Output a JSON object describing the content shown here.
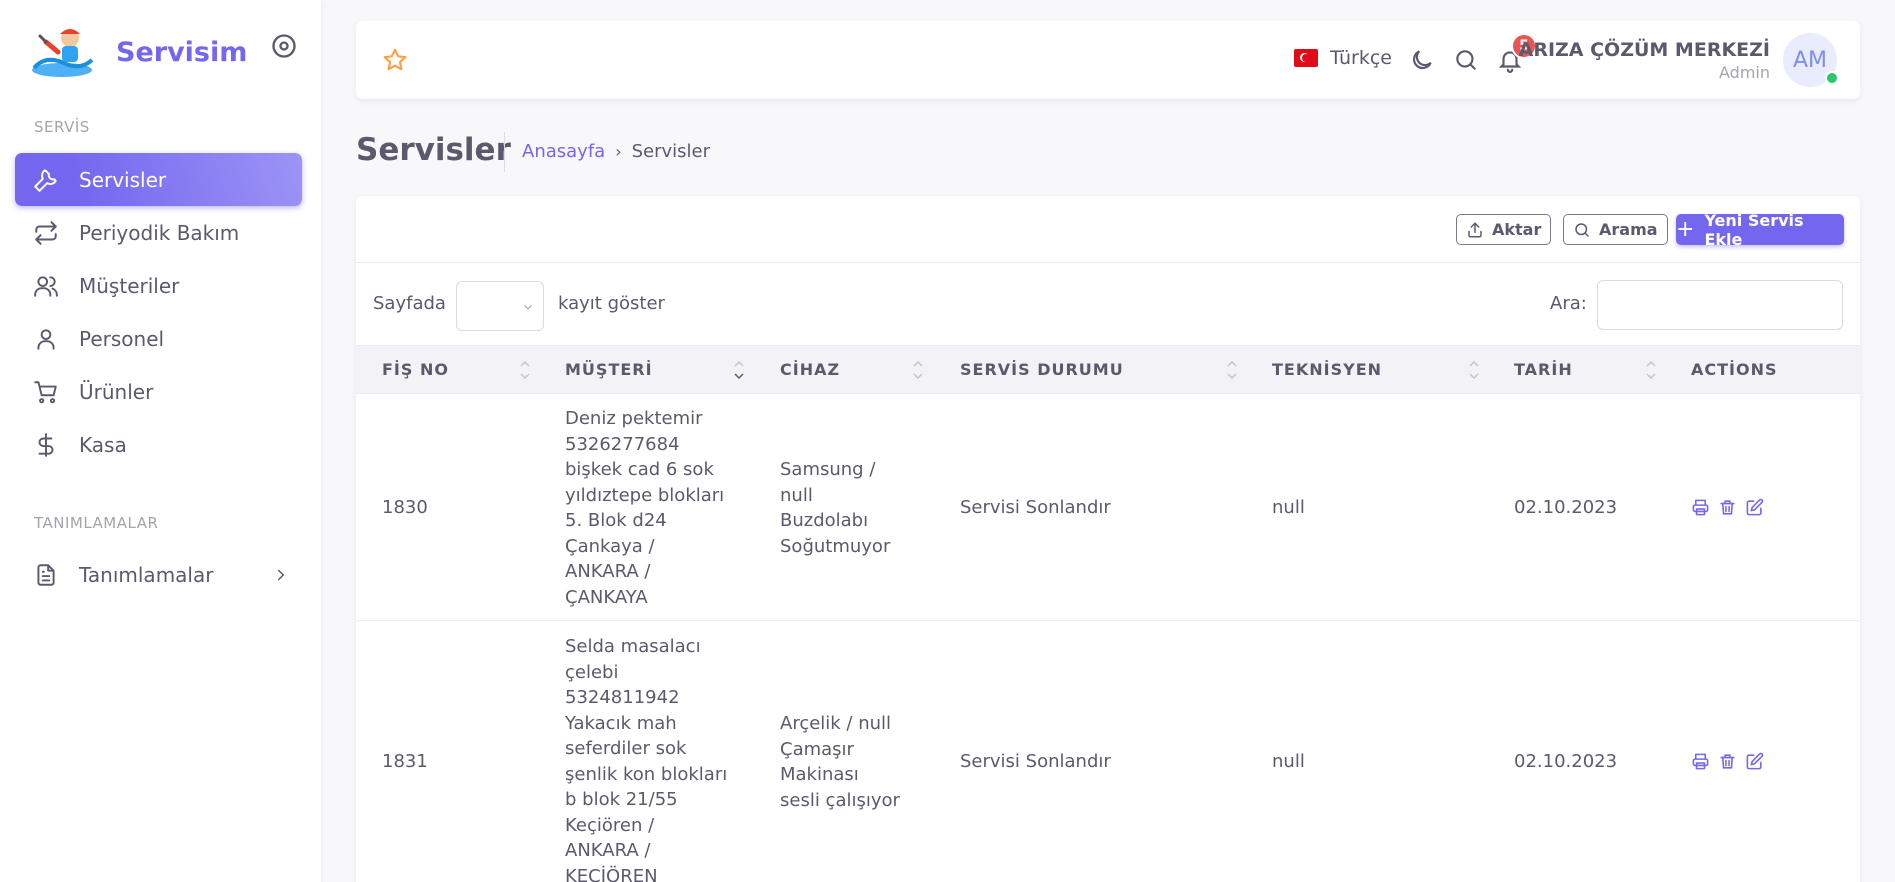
{
  "brand": {
    "name": "Servisim"
  },
  "sidebar": {
    "section1": "SERVİS",
    "items": [
      {
        "label": "Servisler",
        "icon": "wrench-icon",
        "active": true
      },
      {
        "label": "Periyodik Bakım",
        "icon": "repeat-icon"
      },
      {
        "label": "Müşteriler",
        "icon": "users-icon"
      },
      {
        "label": "Personel",
        "icon": "user-icon"
      },
      {
        "label": "Ürünler",
        "icon": "shopping-cart-icon"
      },
      {
        "label": "Kasa",
        "icon": "dollar-icon"
      }
    ],
    "section2": "TANIMLAMALAR",
    "defs_item": {
      "label": "Tanımlamalar",
      "icon": "file-text-icon"
    }
  },
  "navbar": {
    "language": "Türkçe",
    "notification_count": "5",
    "user_name": "ARIZA ÇÖZÜM MERKEZİ",
    "user_role": "Admin",
    "avatar_initials": "AM"
  },
  "page": {
    "title": "Servisler",
    "breadcrumb_home": "Anasayfa",
    "breadcrumb_current": "Servisler"
  },
  "toolbar": {
    "export_label": "Aktar",
    "search_label": "Arama",
    "add_label": "Yeni Servis Ekle"
  },
  "table_controls": {
    "length_prefix": "Sayfada",
    "length_value": "",
    "length_suffix": "kayıt göster",
    "search_label": "Ara:",
    "search_value": ""
  },
  "table": {
    "columns": [
      "FİŞ NO",
      "MÜŞTERİ",
      "CİHAZ",
      "SERVİS DURUMU",
      "TEKNİSYEN",
      "TARİH",
      "ACTİONS"
    ],
    "rows": [
      {
        "fis_no": "1830",
        "musteri": [
          "Deniz pektemir",
          "5326277684",
          "bişkek cad 6 sok",
          "yıldıztepe blokları",
          "5. Blok d24",
          "Çankaya /",
          "ANKARA /",
          "ÇANKAYA"
        ],
        "cihaz": [
          "Samsung /",
          "null",
          "Buzdolabı",
          "Soğutmuyor"
        ],
        "durum": "Servisi Sonlandır",
        "teknisyen": "null",
        "tarih": "02.10.2023"
      },
      {
        "fis_no": "1831",
        "musteri": [
          "Selda masalacı",
          "çelebi",
          "5324811942",
          "Yakacık mah",
          "seferdiler sok",
          "şenlik kon blokları",
          "b blok 21/55",
          "Keçiören /",
          "ANKARA /",
          "KEÇİÖREN"
        ],
        "cihaz": [
          "Arçelik / null",
          "Çamaşır",
          "Makinası",
          "sesli çalışıyor"
        ],
        "durum": "Servisi Sonlandır",
        "teknisyen": "null",
        "tarih": "02.10.2023"
      }
    ]
  },
  "colors": {
    "primary": "#7367f0",
    "badge": "#ea5455",
    "online": "#28c76f",
    "star": "#ff9f43"
  }
}
